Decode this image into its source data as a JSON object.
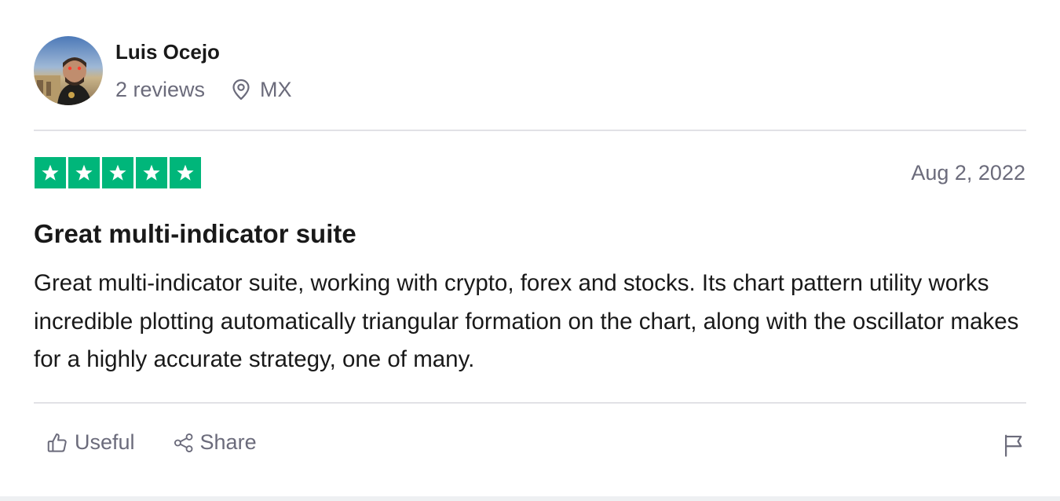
{
  "reviewer": {
    "name": "Luis Ocejo",
    "reviews_count": "2 reviews",
    "location": "MX",
    "avatar_icon": "person-photo"
  },
  "review": {
    "rating": 5,
    "rating_max": 5,
    "star_color": "#00b67a",
    "date": "Aug 2, 2022",
    "title": "Great multi-indicator suite",
    "text": "Great multi-indicator suite, working with crypto, forex and stocks. Its chart pattern utility works incredible plotting automatically triangular formation on the chart, along with the oscillator makes for a highly accurate strategy, one of many."
  },
  "actions": {
    "useful_label": "Useful",
    "useful_icon": "thumbs-up-icon",
    "share_label": "Share",
    "share_icon": "share-icon",
    "report_icon": "flag-icon"
  }
}
